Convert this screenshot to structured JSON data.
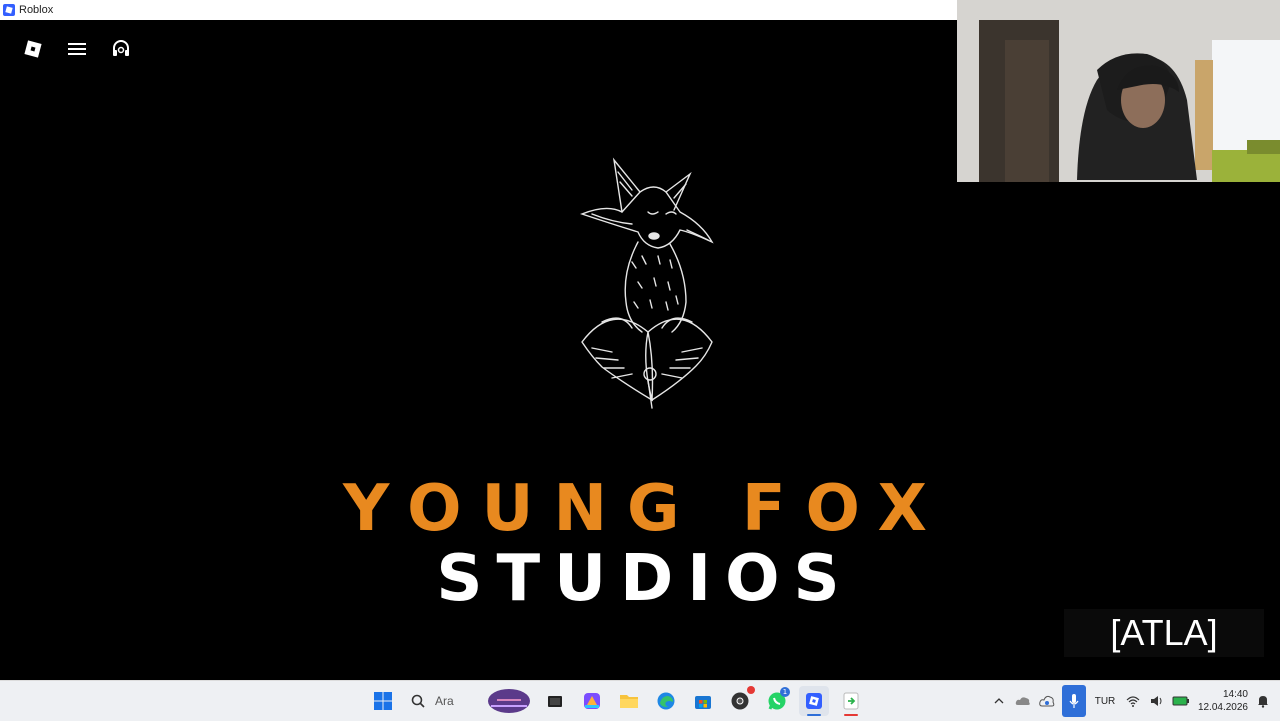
{
  "window": {
    "title": "Roblox"
  },
  "game": {
    "brand_line1": "YOUNG FOX",
    "brand_line2": "STUDIOS",
    "colors": {
      "accent": "#e8891f",
      "text": "#ffffff",
      "background": "#000000"
    }
  },
  "topbar": {
    "icons": [
      "roblox-logo-icon",
      "menu-icon",
      "headset-icon"
    ]
  },
  "caption": "[ATLA]",
  "taskbar": {
    "search_placeholder": "Ara",
    "apps": [
      "file-explorer-icon",
      "copilot-icon",
      "folder-icon",
      "edge-icon",
      "store-icon",
      "chrome-icon",
      "whatsapp-icon",
      "roblox-icon",
      "app-icon"
    ],
    "whatsapp_badge": "1",
    "language": "TUR",
    "time": "14:40",
    "date": "12.04.2026"
  }
}
